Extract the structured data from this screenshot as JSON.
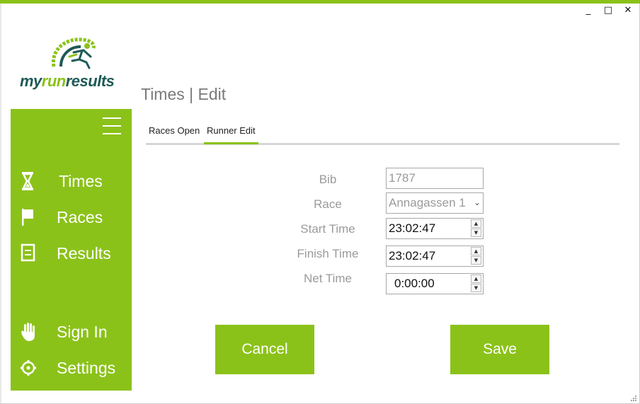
{
  "colors": {
    "accent": "#8bc21a",
    "logo_dark": "#1e5a56",
    "label_gray": "#9a9a9a"
  },
  "window": {
    "minimize": "_",
    "maximize": "□",
    "close": "✕"
  },
  "logo": {
    "part1": "my",
    "part2": "run",
    "part3": "results"
  },
  "page_title": "Times | Edit",
  "sidebar": {
    "menu_icon": "hamburger-icon",
    "items": [
      {
        "label": "Times",
        "icon": "hourglass-icon"
      },
      {
        "label": "Races",
        "icon": "flag-icon"
      },
      {
        "label": "Results",
        "icon": "document-icon"
      },
      {
        "label": "Sign In",
        "icon": "hand-icon"
      },
      {
        "label": "Settings",
        "icon": "gear-icon"
      }
    ]
  },
  "tabs": [
    {
      "label": "Races Open",
      "active": false
    },
    {
      "label": "Runner Edit",
      "active": true
    }
  ],
  "form": {
    "bib": {
      "label": "Bib",
      "value": "1787"
    },
    "race": {
      "label": "Race",
      "value": "Annagassen 1"
    },
    "start_time": {
      "label": "Start Time",
      "value": "23:02:47"
    },
    "finish_time": {
      "label": "Finish Time",
      "value": "23:02:47"
    },
    "net_time": {
      "label": "Net Time",
      "value": "0:00:00"
    }
  },
  "buttons": {
    "cancel": "Cancel",
    "save": "Save"
  }
}
